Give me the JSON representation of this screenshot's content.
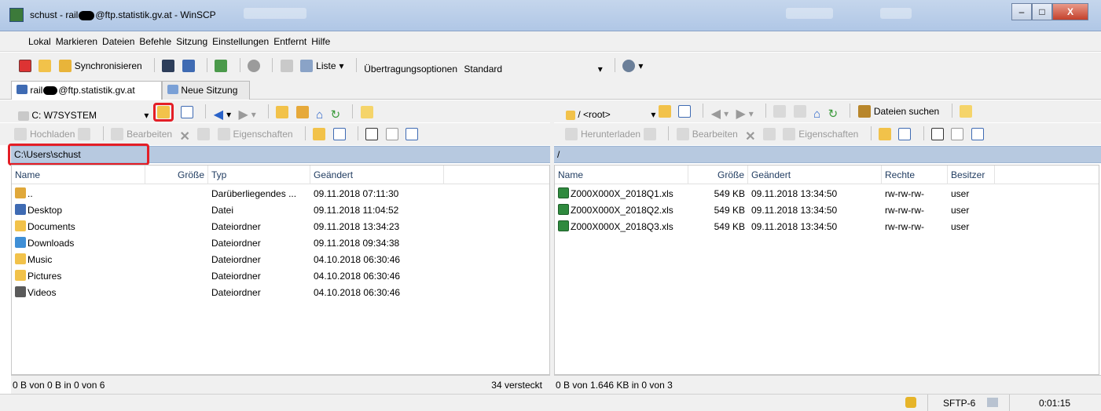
{
  "window": {
    "title_prefix": "schust - rail",
    "title_suffix": "@ftp.statistik.gv.at - WinSCP",
    "minimize": "–",
    "maximize": "□",
    "close": "X"
  },
  "menu": [
    "Lokal",
    "Markieren",
    "Dateien",
    "Befehle",
    "Sitzung",
    "Einstellungen",
    "Entfernt",
    "Hilfe"
  ],
  "toolbar": {
    "sync_label": "Synchronisieren",
    "list_label": "Liste",
    "transfer_label": "Übertragungsoptionen",
    "transfer_value": "Standard"
  },
  "tabs": {
    "session_prefix": "rail",
    "session_suffix": "@ftp.statistik.gv.at",
    "new_session": "Neue Sitzung"
  },
  "left": {
    "drive": "C: W7SYSTEM",
    "actions": {
      "upload": "Hochladen",
      "edit": "Bearbeiten",
      "props": "Eigenschaften"
    },
    "path": "C:\\Users\\schust",
    "columns": [
      "Name",
      "Größe",
      "Typ",
      "Geändert"
    ],
    "rows": [
      {
        "icon": "parent-dir-icon",
        "name": "..",
        "size": "",
        "type": "Darüberliegendes ...",
        "changed": "09.11.2018 07:11:30"
      },
      {
        "icon": "desktop-icon",
        "name": "Desktop",
        "size": "",
        "type": "Datei",
        "changed": "09.11.2018 11:04:52"
      },
      {
        "icon": "documents-folder-icon",
        "name": "Documents",
        "size": "",
        "type": "Dateiordner",
        "changed": "09.11.2018 13:34:23"
      },
      {
        "icon": "downloads-folder-icon",
        "name": "Downloads",
        "size": "",
        "type": "Dateiordner",
        "changed": "09.11.2018 09:34:38"
      },
      {
        "icon": "music-folder-icon",
        "name": "Music",
        "size": "",
        "type": "Dateiordner",
        "changed": "04.10.2018 06:30:46"
      },
      {
        "icon": "pictures-folder-icon",
        "name": "Pictures",
        "size": "",
        "type": "Dateiordner",
        "changed": "04.10.2018 06:30:46"
      },
      {
        "icon": "videos-folder-icon",
        "name": "Videos",
        "size": "",
        "type": "Dateiordner",
        "changed": "04.10.2018 06:30:46"
      }
    ],
    "status": "0 B von 0 B in 0 von 6",
    "hidden": "34 versteckt"
  },
  "right": {
    "dir": "/ <root>",
    "find_label": "Dateien suchen",
    "actions": {
      "download": "Herunterladen",
      "edit": "Bearbeiten",
      "props": "Eigenschaften"
    },
    "path": "/",
    "columns": [
      "Name",
      "Größe",
      "Geändert",
      "Rechte",
      "Besitzer"
    ],
    "rows": [
      {
        "name": "Z000X000X_2018Q1.xls",
        "size": "549 KB",
        "changed": "09.11.2018 13:34:50",
        "rights": "rw-rw-rw-",
        "owner": "user"
      },
      {
        "name": "Z000X000X_2018Q2.xls",
        "size": "549 KB",
        "changed": "09.11.2018 13:34:50",
        "rights": "rw-rw-rw-",
        "owner": "user"
      },
      {
        "name": "Z000X000X_2018Q3.xls",
        "size": "549 KB",
        "changed": "09.11.2018 13:34:50",
        "rights": "rw-rw-rw-",
        "owner": "user"
      }
    ],
    "status": "0 B von 1.646 KB in 0 von 3"
  },
  "statusbar": {
    "protocol": "SFTP-6",
    "time": "0:01:15"
  },
  "colors": {
    "path_bar": "#b7c9e0",
    "highlight": "#e41e26",
    "title_bar": "#c5d6ec"
  }
}
